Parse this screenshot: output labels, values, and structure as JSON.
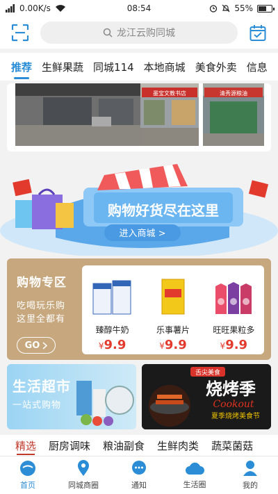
{
  "status_bar": {
    "network": "0.00K/s",
    "time": "08:54",
    "battery": "55%"
  },
  "header": {
    "scan_icon": "scan-icon",
    "search_placeholder": "龙江云购同城",
    "calendar_icon": "calendar-check-icon"
  },
  "tabs": [
    {
      "label": "推荐"
    },
    {
      "label": "生鲜果蔬"
    },
    {
      "label": "同城114"
    },
    {
      "label": "本地商城"
    },
    {
      "label": "美食外卖"
    },
    {
      "label": "信息"
    }
  ],
  "photos": {
    "sign1": "墨宝文教书店",
    "sign2": "清秀源粮油"
  },
  "banner": {
    "title": "购物好货尽在这里",
    "button": "进入商城 >"
  },
  "shopping_zone": {
    "title": "购物专区",
    "subtitle_1": "吃喝玩乐购",
    "subtitle_2": "这里全都有",
    "go_label": "GO",
    "products": [
      {
        "name": "臻醇牛奶",
        "currency": "¥",
        "price": "9.9"
      },
      {
        "name": "乐事薯片",
        "currency": "¥",
        "price": "9.9"
      },
      {
        "name": "旺旺果粒多",
        "currency": "¥",
        "price": "9.9"
      }
    ]
  },
  "promos": {
    "supermarket_title": "生活超市",
    "supermarket_sub": "一站式购物",
    "bbq_tag": "舌尖美食",
    "bbq_title": "烧烤季",
    "bbq_en": "Cookout",
    "bbq_sub": "夏季烧烤美食节"
  },
  "categories": [
    {
      "label": "精选"
    },
    {
      "label": "厨房调味"
    },
    {
      "label": "粮油副食"
    },
    {
      "label": "生鲜肉类"
    },
    {
      "label": "蔬菜菌菇"
    }
  ],
  "bottom_nav": [
    {
      "label": "首页",
      "icon": "home-icon"
    },
    {
      "label": "同城商圈",
      "icon": "location-pin-icon"
    },
    {
      "label": "通知",
      "icon": "chat-bubble-icon"
    },
    {
      "label": "生活圈",
      "icon": "cloud-icon"
    },
    {
      "label": "我的",
      "icon": "user-icon"
    }
  ],
  "colors": {
    "accent": "#2b8dd6",
    "price": "#e23b2e",
    "zone_bg": "#c7a77d"
  }
}
